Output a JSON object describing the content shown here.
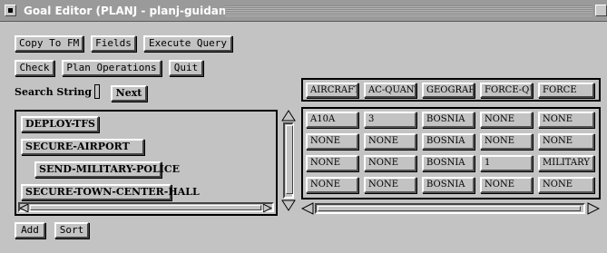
{
  "window": {
    "title": "Goal Editor (PLANJ - planj-guidance)"
  },
  "toolbar": {
    "copy_to_fm": "Copy To FM",
    "fields": "Fields",
    "execute_query": "Execute Query",
    "check": "Check",
    "plan_operations": "Plan Operations",
    "quit": "Quit"
  },
  "search": {
    "label": "Search String",
    "value": "",
    "next": "Next"
  },
  "goals": [
    "DEPLOY-TFS",
    "SECURE-AIRPORT",
    "SEND-MILITARY-POLICE",
    "SECURE-TOWN-CENTER-HALL"
  ],
  "table": {
    "headers": [
      "AIRCRAFT",
      "AC-QUANT",
      "GEOGRAPH",
      "FORCE-QU",
      "FORCE"
    ],
    "rows": [
      [
        "A10A",
        "3",
        "BOSNIA",
        "NONE",
        "NONE"
      ],
      [
        "NONE",
        "NONE",
        "BOSNIA",
        "NONE",
        "NONE"
      ],
      [
        "NONE",
        "NONE",
        "BOSNIA",
        "1",
        "MILITARY"
      ],
      [
        "NONE",
        "NONE",
        "BOSNIA",
        "NONE",
        "NONE"
      ]
    ]
  },
  "bottom": {
    "add": "Add",
    "sort": "Sort"
  },
  "icons": [
    "window-menu-icon",
    "maximize-icon",
    "arrow-up-icon",
    "arrow-down-icon",
    "arrow-left-icon",
    "arrow-right-icon"
  ]
}
